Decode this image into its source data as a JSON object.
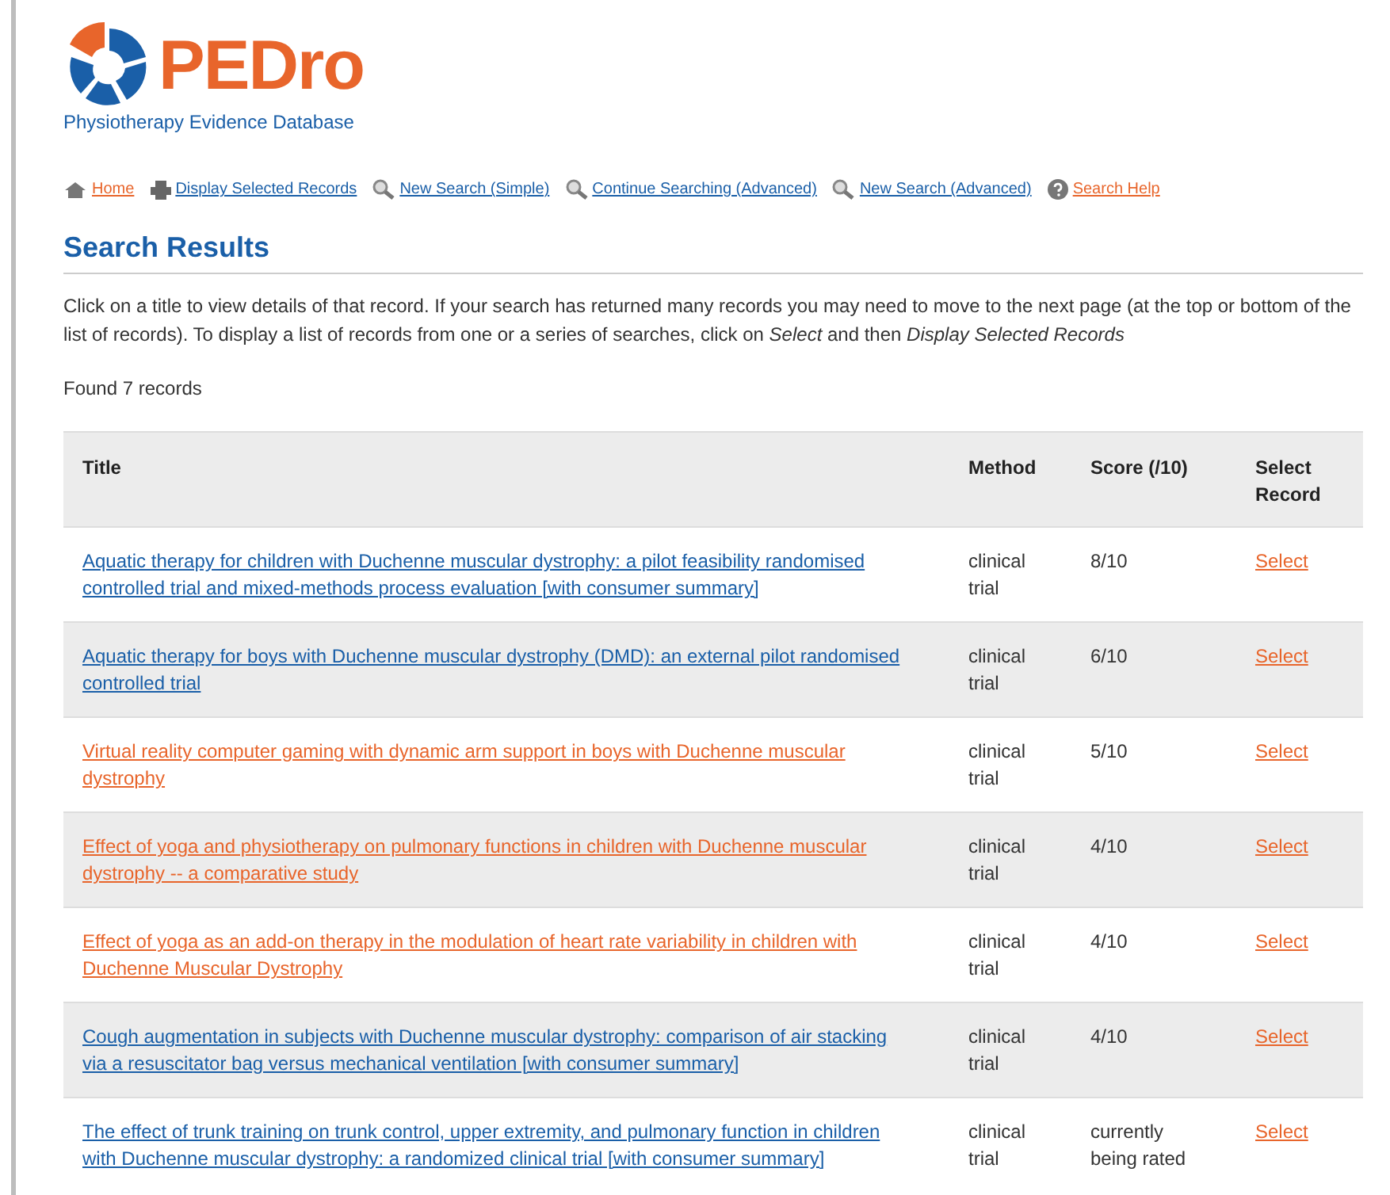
{
  "logo": {
    "name": "PEDro",
    "tagline": "Physiotherapy Evidence Database"
  },
  "nav": [
    {
      "label": "Home",
      "visited": true
    },
    {
      "label": "Display Selected Records",
      "visited": false
    },
    {
      "label": "New Search (Simple)",
      "visited": false
    },
    {
      "label": "Continue Searching (Advanced)",
      "visited": false
    },
    {
      "label": "New Search (Advanced)",
      "visited": false
    },
    {
      "label": "Search Help",
      "visited": true
    }
  ],
  "heading": "Search Results",
  "intro": "Click on a title to view details of that record. If your search has returned many records you may need to move to the next page (at the top or bottom of the list of records). To display a list of records from one or a series of searches, click on *Select* and then *Display Selected Records*",
  "found": "Found 7 records",
  "table": {
    "columns": [
      "Title",
      "Method",
      "Score (/10)",
      "Select Record"
    ],
    "rows": [
      {
        "title": "Aquatic therapy for children with Duchenne muscular dystrophy: a pilot feasibility randomised controlled trial and mixed-methods process evaluation [with consumer summary]",
        "visited": false,
        "method": "clinical trial",
        "score": "8/10",
        "select": "Select"
      },
      {
        "title": "Aquatic therapy for boys with Duchenne muscular dystrophy (DMD): an external pilot randomised controlled trial",
        "visited": false,
        "method": "clinical trial",
        "score": "6/10",
        "select": "Select"
      },
      {
        "title": "Virtual reality computer gaming with dynamic arm support in boys with Duchenne muscular dystrophy",
        "visited": true,
        "method": "clinical trial",
        "score": "5/10",
        "select": "Select"
      },
      {
        "title": "Effect of yoga and physiotherapy on pulmonary functions in children with Duchenne muscular dystrophy -- a comparative study",
        "visited": true,
        "method": "clinical trial",
        "score": "4/10",
        "select": "Select"
      },
      {
        "title": "Effect of yoga as an add-on therapy in the modulation of heart rate variability in children with Duchenne Muscular Dystrophy",
        "visited": true,
        "method": "clinical trial",
        "score": "4/10",
        "select": "Select"
      },
      {
        "title": "Cough augmentation in subjects with Duchenne muscular dystrophy: comparison of air stacking via a resuscitator bag versus mechanical ventilation [with consumer summary]",
        "visited": false,
        "method": "clinical trial",
        "score": "4/10",
        "select": "Select"
      },
      {
        "title": "The effect of trunk training on trunk control, upper extremity, and pulmonary function in children with Duchenne muscular dystrophy: a randomized clinical trial [with consumer summary]",
        "visited": false,
        "method": "clinical trial",
        "score": "currently being rated",
        "select": "Select"
      }
    ]
  }
}
